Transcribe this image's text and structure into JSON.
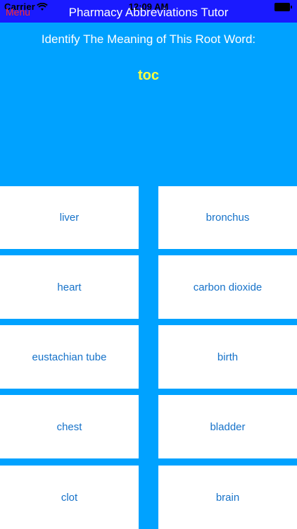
{
  "status_bar": {
    "carrier": "Carrier",
    "time": "12:09 AM"
  },
  "nav": {
    "menu_label": "Menu",
    "title": "Pharmacy Abbreviations Tutor"
  },
  "question": {
    "prompt": "Identify The Meaning of This Root Word:",
    "root_word": "toc"
  },
  "answers": [
    "liver",
    "bronchus",
    "heart",
    "carbon dioxide",
    "eustachian tube",
    "birth",
    "chest",
    "bladder",
    "clot",
    "brain"
  ],
  "colors": {
    "background": "#00a2ff",
    "nav_background": "#1a1aff",
    "menu_text": "#ff2a2a",
    "root_word": "#ffff3b",
    "answer_text": "#1672c9"
  },
  "icons": {
    "wifi": "wifi-icon",
    "battery": "battery-icon"
  }
}
